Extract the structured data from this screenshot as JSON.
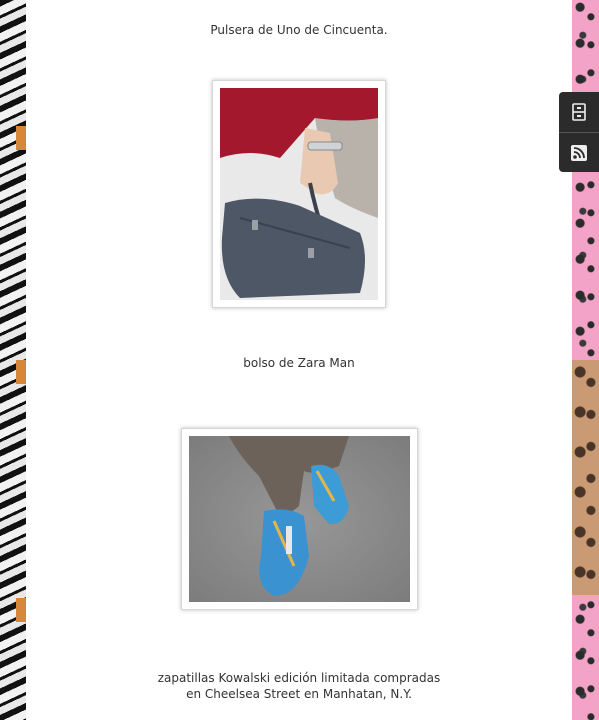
{
  "captions": {
    "bracelet": "Pulsera de Uno de Cincuenta.",
    "bag": "bolso de Zara Man",
    "sneakers": "zapatillas Kowalski edición limitada compradas\nen Cheelsea Street en Manhatan, N.Y."
  },
  "side_toolbar": {
    "icons": [
      "archive-icon",
      "rss-icon"
    ]
  }
}
